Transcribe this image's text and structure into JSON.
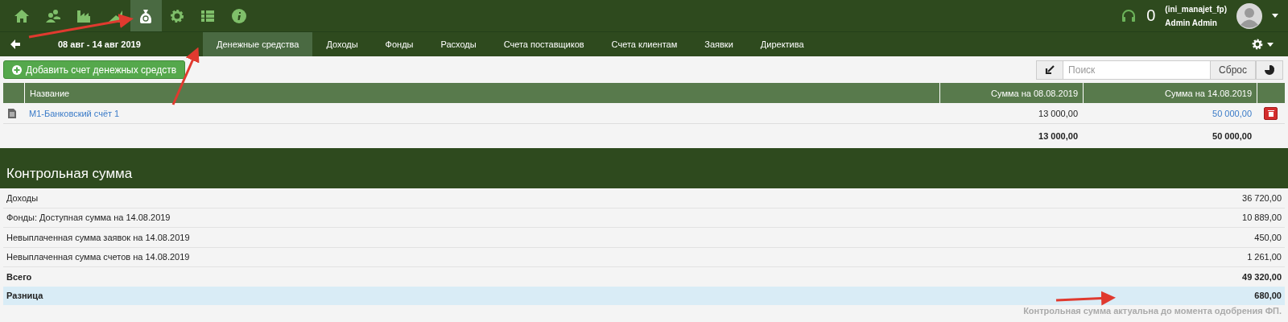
{
  "nav_icons": [
    {
      "kind": "home",
      "selected": false
    },
    {
      "kind": "users",
      "selected": false
    },
    {
      "kind": "factory",
      "selected": false
    },
    {
      "kind": "chart",
      "selected": false
    },
    {
      "kind": "money",
      "selected": true
    },
    {
      "kind": "gear",
      "selected": false
    },
    {
      "kind": "list",
      "selected": false
    },
    {
      "kind": "info",
      "selected": false
    }
  ],
  "user": {
    "notifications": "0",
    "login": "(ini_manajet_fp)",
    "name": "Admin Admin"
  },
  "subnav": {
    "period": "08 авг - 14 авг 2019",
    "tabs": [
      {
        "label": "Денежные средства",
        "selected": true
      },
      {
        "label": "Доходы",
        "selected": false
      },
      {
        "label": "Фонды",
        "selected": false
      },
      {
        "label": "Расходы",
        "selected": false
      },
      {
        "label": "Счета поставщиков",
        "selected": false
      },
      {
        "label": "Счета клиентам",
        "selected": false
      },
      {
        "label": "Заявки",
        "selected": false
      },
      {
        "label": "Директива",
        "selected": false
      }
    ]
  },
  "toolbar": {
    "add_button": "Добавить счет денежных средств",
    "search": {
      "placeholder": "Поиск"
    },
    "reset_button": "Сброс"
  },
  "table": {
    "columns": [
      "Название",
      "Сумма на 08.08.2019",
      "Сумма на 14.08.2019"
    ],
    "rows": [
      {
        "name": "M1-Банковский счёт 1",
        "start": "13 000,00",
        "end": "50 000,00"
      }
    ],
    "totals": {
      "start": "13 000,00",
      "end": "50 000,00"
    }
  },
  "checksum": {
    "title": "Контрольная сумма",
    "rows": [
      {
        "kind": "normal",
        "label": "Доходы",
        "value": "36 720,00"
      },
      {
        "kind": "normal",
        "label": "Фонды: Доступная сумма на 14.08.2019",
        "value": "10 889,00"
      },
      {
        "kind": "normal",
        "label": "Невыплаченная сумма заявок на 14.08.2019",
        "value": "450,00"
      },
      {
        "kind": "normal",
        "label": "Невыплаченная сумма счетов на 14.08.2019",
        "value": "1 261,00"
      },
      {
        "kind": "total",
        "label": "Всего",
        "value": "49 320,00"
      },
      {
        "kind": "difference",
        "label": "Разница",
        "value": "680,00"
      }
    ],
    "note": "Контрольная сумма актуальна до момента одобрения ФП."
  }
}
